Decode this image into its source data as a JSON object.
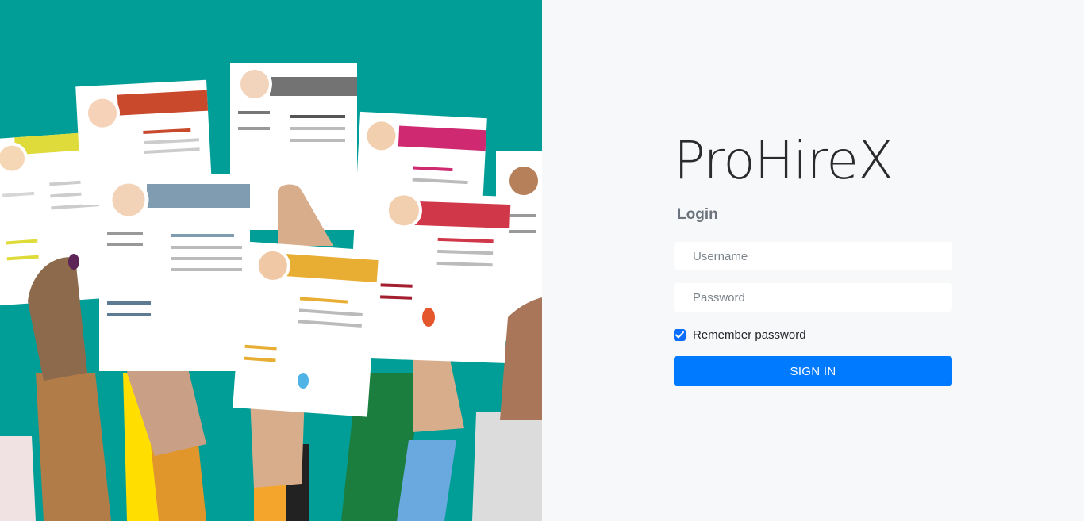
{
  "brand": {
    "title": "ProHireX"
  },
  "login": {
    "heading": "Login",
    "username_placeholder": "Username",
    "password_placeholder": "Password",
    "remember_label": "Remember password",
    "remember_checked": true,
    "signin_label": "SIGN IN"
  },
  "colors": {
    "hero_background": "#009e96",
    "panel_background": "#f7f8fa",
    "primary": "#007bff"
  },
  "icons": {
    "checkbox": "checkmark-icon"
  }
}
